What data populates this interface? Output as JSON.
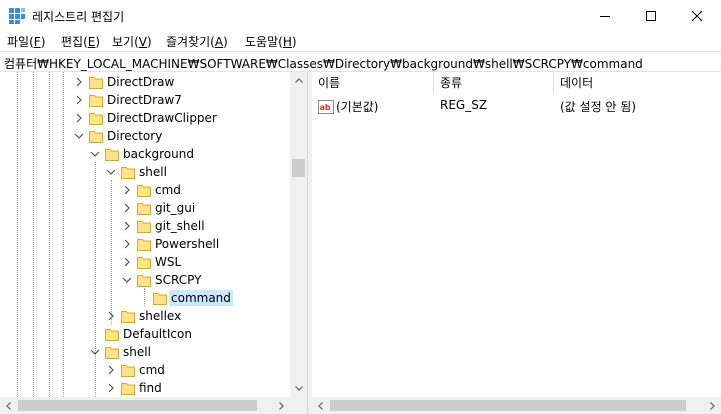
{
  "window": {
    "title": "레지스트리 편집기",
    "controls": {
      "minimize": "—",
      "maximize": "☐",
      "close": "✕"
    }
  },
  "menu": [
    {
      "label": "파일",
      "key": "F"
    },
    {
      "label": "편집",
      "key": "E"
    },
    {
      "label": "보기",
      "key": "V"
    },
    {
      "label": "즐겨찾기",
      "key": "A"
    },
    {
      "label": "도움말",
      "key": "H"
    }
  ],
  "address": "컴퓨터₩HKEY_LOCAL_MACHINE₩SOFTWARE₩Classes₩Directory₩background₩shell₩SCRCPY₩command",
  "tree": {
    "nodes": [
      {
        "label": "DirectDraw",
        "chevron": "right"
      },
      {
        "label": "DirectDraw7",
        "chevron": "right"
      },
      {
        "label": "DirectDrawClipper",
        "chevron": "right"
      },
      {
        "label": "Directory",
        "chevron": "down"
      },
      {
        "label": "background",
        "chevron": "down"
      },
      {
        "label": "shell",
        "chevron": "down"
      },
      {
        "label": "cmd",
        "chevron": "right"
      },
      {
        "label": "git_gui",
        "chevron": "right"
      },
      {
        "label": "git_shell",
        "chevron": "right"
      },
      {
        "label": "Powershell",
        "chevron": "right"
      },
      {
        "label": "WSL",
        "chevron": "right"
      },
      {
        "label": "SCRCPY",
        "chevron": "down"
      },
      {
        "label": "command",
        "chevron": "none",
        "selected": true
      },
      {
        "label": "shellex",
        "chevron": "right"
      },
      {
        "label": "DefaultIcon",
        "chevron": "none"
      },
      {
        "label": "shell",
        "chevron": "down"
      },
      {
        "label": "cmd",
        "chevron": "right"
      },
      {
        "label": "find",
        "chevron": "right"
      }
    ]
  },
  "list": {
    "columns": [
      "이름",
      "종류",
      "데이터"
    ],
    "rows": [
      {
        "name": "(기본값)",
        "type": "REG_SZ",
        "data": "(값 설정 안 됨)",
        "icon": "string-value-icon"
      }
    ]
  },
  "colors": {
    "selection": "#cce8ff",
    "folder_fill": "#ffe38a",
    "folder_edge": "#d9a53a",
    "scrollbar": "#f0f0f0",
    "thumb": "#cdcdcd"
  }
}
